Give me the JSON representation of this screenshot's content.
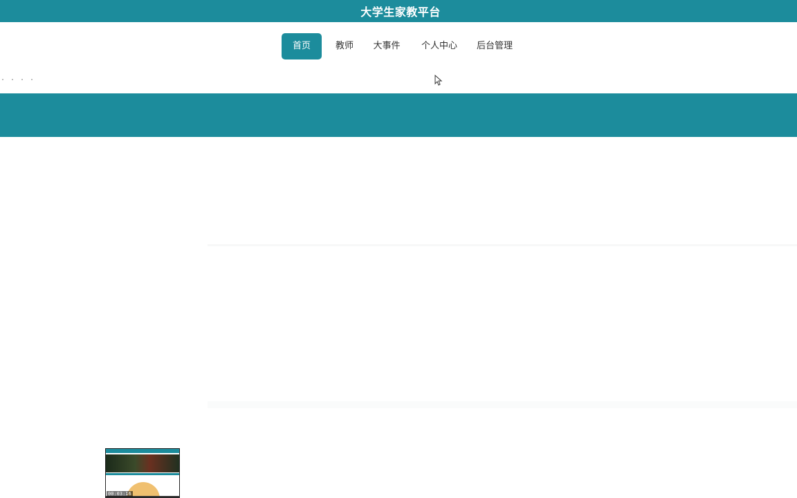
{
  "header": {
    "title": "大学生家教平台"
  },
  "nav": {
    "items": [
      {
        "label": "首页",
        "active": true
      },
      {
        "label": "教师",
        "active": false
      },
      {
        "label": "大事件",
        "active": false
      },
      {
        "label": "个人中心",
        "active": false
      },
      {
        "label": "后台管理",
        "active": false
      }
    ]
  },
  "theme": {
    "primary": "#1c8c9c",
    "background": "#ffffff",
    "text": "#333333"
  },
  "video_preview": {
    "timestamp": "00:03:16"
  },
  "icons": {
    "cursor": "mouse-pointer-icon",
    "watermark": "bilibili-logo-icon"
  }
}
